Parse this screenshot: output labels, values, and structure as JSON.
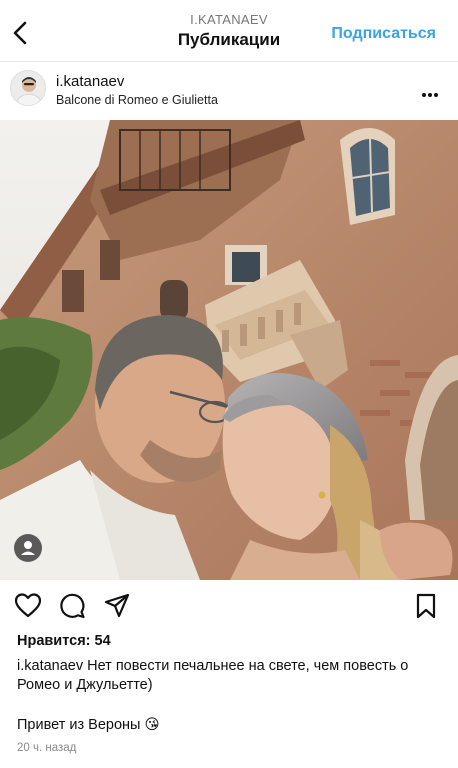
{
  "topbar": {
    "account_name": "I.KATANAEV",
    "title": "Публикации",
    "follow_label": "Подписаться",
    "back_icon": "chevron-left-icon"
  },
  "post": {
    "username": "i.katanaev",
    "location": "Balcone di Romeo e Giulietta",
    "more_icon": "more-horizontal-icon",
    "image_alt": "Пара целуется на фоне балкона Джульетты",
    "likes_text": "Нравится: 54",
    "caption_user": "i.katanaev",
    "caption_text": "Нет повести печальнее на свете, чем повесть о Ромео и Джульетте)",
    "caption_line2": "Привет из Вероны 😘",
    "time_ago": "20 ч. назад"
  },
  "actions": {
    "like_icon": "heart-icon",
    "comment_icon": "comment-icon",
    "share_icon": "send-icon",
    "save_icon": "bookmark-icon",
    "tag_icon": "user-tag-icon"
  },
  "colors": {
    "accent": "#3aa3e3",
    "text": "#111111",
    "muted": "#8a8a8a"
  }
}
